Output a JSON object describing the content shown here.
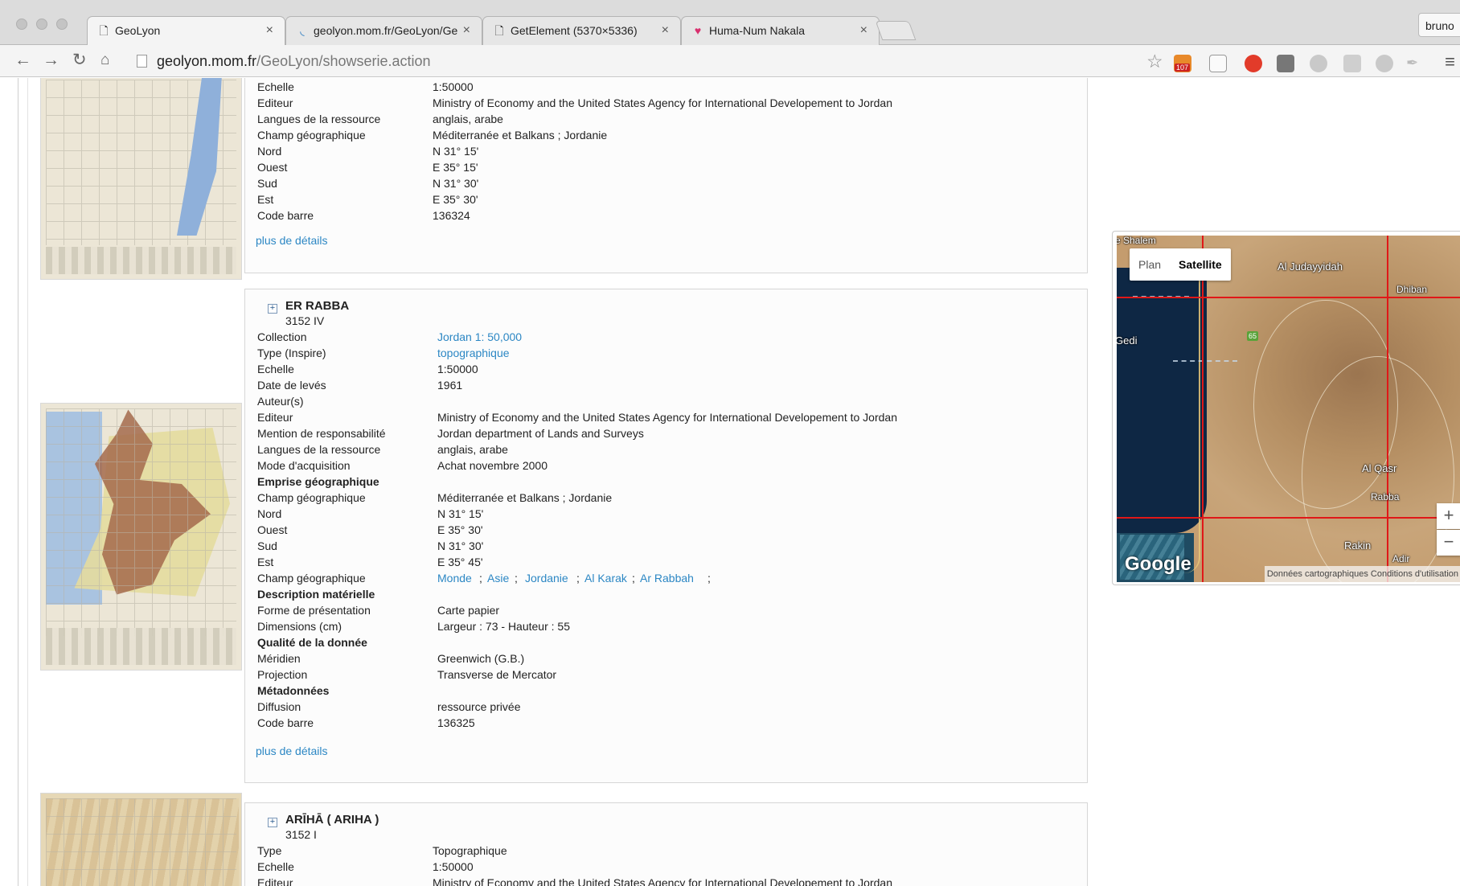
{
  "browser": {
    "tabs": [
      {
        "title": "GeoLyon",
        "active": true
      },
      {
        "title": "geolyon.mom.fr/GeoLyon/Ge"
      },
      {
        "title": "GetElement (5370×5336)"
      },
      {
        "title": "Huma-Num Nakala"
      }
    ],
    "close_glyph": "×",
    "profile": "bruno",
    "url_host": "geolyon.mom.fr",
    "url_path": "/GeoLyon/showserie.action",
    "rss_badge": "107"
  },
  "records": [
    {
      "fields": [
        {
          "label": "Echelle",
          "value": "1:50000"
        },
        {
          "label": "Editeur",
          "value": "Ministry of Economy and the United States Agency for International Developement to Jordan"
        },
        {
          "label": "Langues de la ressource",
          "value": "anglais, arabe"
        },
        {
          "label": "Champ géographique",
          "value": "Méditerranée et Balkans ; Jordanie"
        },
        {
          "label": "Nord",
          "value": "N 31° 15'"
        },
        {
          "label": "Ouest",
          "value": "E 35° 15'"
        },
        {
          "label": "Sud",
          "value": "N 31° 30'"
        },
        {
          "label": "Est",
          "value": "E 35° 30'"
        },
        {
          "label": "Code barre",
          "value": "136324"
        }
      ],
      "details_label": "plus de détails"
    },
    {
      "title": "ER RABBA",
      "subtitle": "3152 IV",
      "fields": [
        {
          "label": "Collection",
          "value": "Jordan 1: 50,000"
        },
        {
          "label": "Type (Inspire)",
          "value": "topographique"
        },
        {
          "label": "Echelle",
          "value": "1:50000"
        },
        {
          "label": "Date de levés",
          "value": "1961"
        },
        {
          "label": "Auteur(s)",
          "value": ""
        },
        {
          "label": "Editeur",
          "value": "Ministry of Economy and the United States Agency for International Developement to Jordan"
        },
        {
          "label": "Mention de responsabilité",
          "value": "Jordan department of Lands and Surveys"
        },
        {
          "label": "Langues de la ressource",
          "value": "anglais, arabe"
        },
        {
          "label": "Mode d'acquisition",
          "value": "Achat novembre 2000"
        },
        {
          "label": "Emprise géographique",
          "value": ""
        },
        {
          "label": "Champ géographique",
          "value": "Méditerranée et Balkans ; Jordanie"
        },
        {
          "label": "Nord",
          "value": "N 31° 15'"
        },
        {
          "label": "Ouest",
          "value": "E 35° 30'"
        },
        {
          "label": "Sud",
          "value": "N 31° 30'"
        },
        {
          "label": "Est",
          "value": "E 35° 45'"
        },
        {
          "label": "Champ géographique",
          "value": ""
        },
        {
          "label": "Description matérielle",
          "value": ""
        },
        {
          "label": "Forme de présentation",
          "value": "Carte papier"
        },
        {
          "label": "Dimensions (cm)",
          "value": "Largeur : 73 - Hauteur : 55"
        },
        {
          "label": "Qualité de la donnée",
          "value": ""
        },
        {
          "label": "Méridien",
          "value": "Greenwich (G.B.)"
        },
        {
          "label": "Projection",
          "value": "Transverse de Mercator"
        },
        {
          "label": "Métadonnées",
          "value": ""
        },
        {
          "label": "Diffusion",
          "value": "ressource privée"
        },
        {
          "label": "Code barre",
          "value": "136325"
        }
      ],
      "geo_links": [
        "Monde",
        "Asie",
        "Jordanie",
        "Al Karak",
        "Ar Rabbah"
      ],
      "geo_separator": ";",
      "details_label": "plus de détails"
    },
    {
      "title": "ARĪHĀ ( ARIHA )",
      "subtitle": "3152 I",
      "fields": [
        {
          "label": "Type",
          "value": "Topographique"
        },
        {
          "label": "Echelle",
          "value": "1:50000"
        },
        {
          "label": "Editeur",
          "value": "Ministry of Economy and the United States Agency for International Developement to Jordan"
        }
      ]
    }
  ],
  "map": {
    "type_plan": "Plan",
    "type_satellite": "Satellite",
    "labels": {
      "shalem": "e Shalem",
      "judayyidah": "Al Judayyidah",
      "dhiban": "Dhiban",
      "gedi": "Gedi",
      "qasr": "Al Qasr",
      "rabba": "Rabba",
      "rakin": "Rakin",
      "adir": "Adir",
      "road": "65"
    },
    "zoom_in": "+",
    "zoom_out": "−",
    "brand": "Google",
    "credits": "Données cartographiques  Conditions d'utilisation"
  }
}
